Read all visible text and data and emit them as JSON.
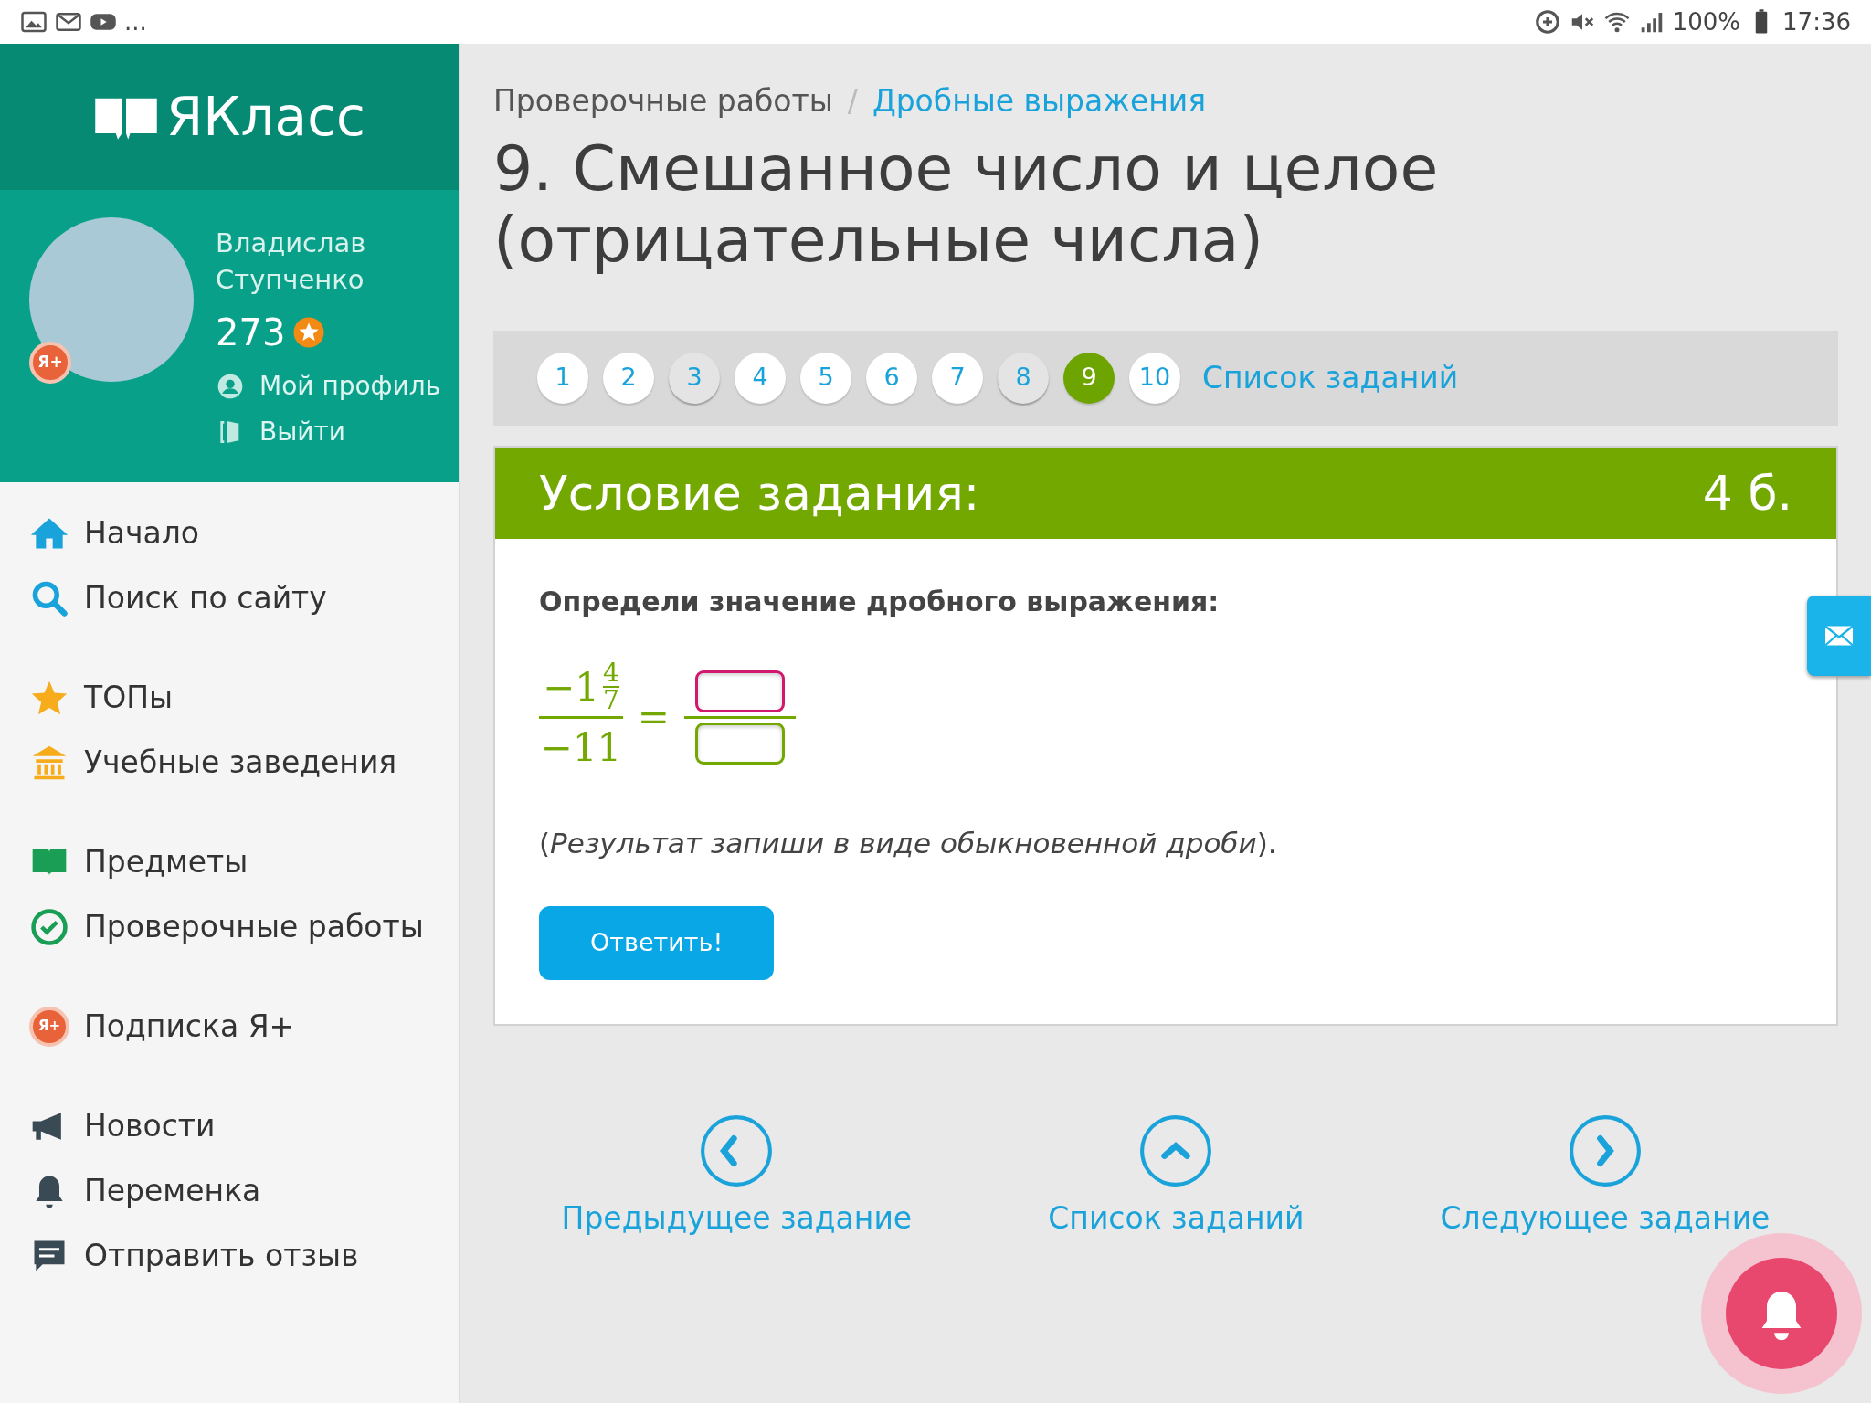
{
  "status_bar": {
    "ellipsis": "...",
    "battery": "100%",
    "time": "17:36"
  },
  "sidebar": {
    "logo": "ЯКласс",
    "user": {
      "first_name": "Владислав",
      "last_name": "Ступченко",
      "points": "273",
      "badge": "Я+"
    },
    "profile_links": [
      {
        "kind": "profile",
        "label": "Мой профиль"
      },
      {
        "kind": "logout",
        "label": "Выйти"
      }
    ],
    "groups": [
      [
        {
          "kind": "home",
          "label": "Начало"
        },
        {
          "kind": "search",
          "label": "Поиск по сайту"
        }
      ],
      [
        {
          "kind": "star",
          "label": "ТОПы"
        },
        {
          "kind": "school",
          "label": "Учебные заведения"
        }
      ],
      [
        {
          "kind": "book",
          "label": "Предметы"
        },
        {
          "kind": "check",
          "label": "Проверочные работы"
        }
      ],
      [
        {
          "kind": "plus",
          "label": "Подписка Я+",
          "badge": "Я+"
        }
      ],
      [
        {
          "kind": "megaphone",
          "label": "Новости"
        },
        {
          "kind": "bell",
          "label": "Переменка"
        },
        {
          "kind": "comment",
          "label": "Отправить отзыв"
        }
      ]
    ]
  },
  "breadcrumb": {
    "separator": "/",
    "items": [
      {
        "label": "Проверочные работы"
      },
      {
        "label": "Дробные выражения"
      }
    ]
  },
  "title": "9. Смешанное число и целое (отрицательные числа)",
  "pagination": {
    "pages": [
      {
        "label": "1",
        "selected": false,
        "visited": false
      },
      {
        "label": "2",
        "selected": false,
        "visited": false
      },
      {
        "label": "3",
        "selected": false,
        "visited": true
      },
      {
        "label": "4",
        "selected": false,
        "visited": false
      },
      {
        "label": "5",
        "selected": false,
        "visited": false
      },
      {
        "label": "6",
        "selected": false,
        "visited": false
      },
      {
        "label": "7",
        "selected": false,
        "visited": false
      },
      {
        "label": "8",
        "selected": false,
        "visited": true
      },
      {
        "label": "9",
        "selected": true,
        "visited": false
      },
      {
        "label": "10",
        "selected": false,
        "visited": false
      }
    ],
    "list_link": "Список заданий"
  },
  "task": {
    "header": "Условие задания:",
    "points": "4 б.",
    "prompt": "Определи значение дробного выражения:",
    "expression": {
      "whole": "−1",
      "frac_num": "4",
      "frac_den": "7",
      "denominator": "−11",
      "equals": "="
    },
    "answer_fields": [
      {
        "focused": true
      },
      {
        "focused": false
      }
    ],
    "note": "(*Результат запиши в виде обыкновенной дроби*).",
    "button": "Ответить!"
  },
  "bottom_nav": [
    {
      "kind": "prev",
      "label": "Предыдущее задание"
    },
    {
      "kind": "up",
      "label": "Список заданий"
    },
    {
      "kind": "next",
      "label": "Следующее задание"
    }
  ]
}
